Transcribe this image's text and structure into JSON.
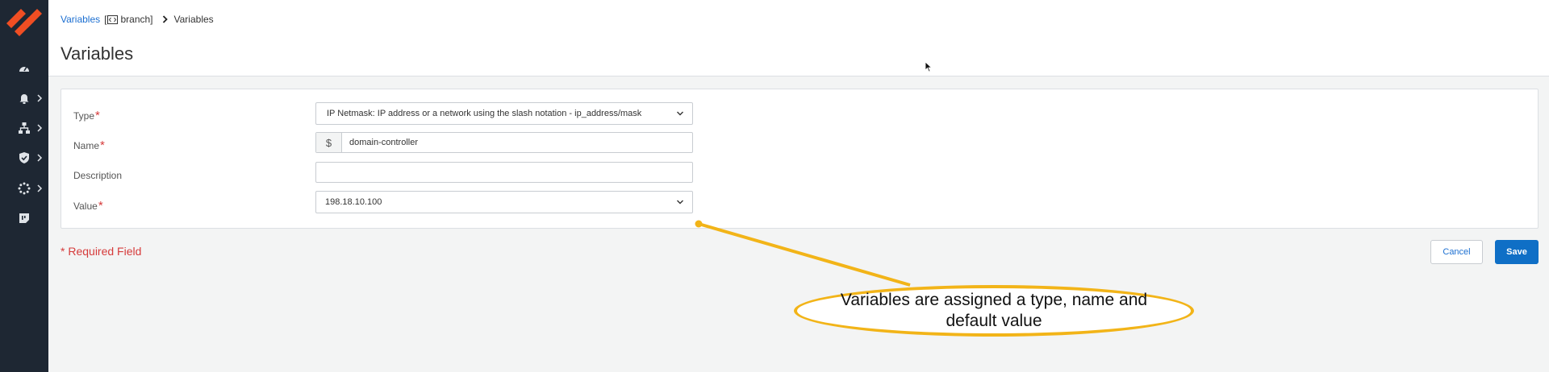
{
  "breadcrumb": {
    "link": "Variables",
    "bracket_open": "[",
    "branch": "branch]",
    "current": "Variables"
  },
  "page_title": "Variables",
  "form": {
    "type": {
      "label": "Type",
      "value": "IP Netmask: IP address or a network using the slash notation - ip_address/mask"
    },
    "name": {
      "label": "Name",
      "prefix": "$",
      "value": "domain-controller"
    },
    "description": {
      "label": "Description",
      "value": ""
    },
    "value": {
      "label": "Value",
      "value": "198.18.10.100"
    },
    "required_marker": "*"
  },
  "required_note": "Required Field",
  "buttons": {
    "cancel": "Cancel",
    "save": "Save"
  },
  "callout": {
    "text": "Variables are assigned a type, name and default value"
  },
  "colors": {
    "sidebar": "#1e2733",
    "brand_orange": "#f04e23",
    "link_blue": "#1c6fd1",
    "save_blue": "#0f6fc6",
    "required_red": "#d63b3b",
    "callout_yellow": "#f2b418"
  },
  "icons": {
    "sidebar": [
      "dashboard-icon",
      "alarm-icon",
      "network-icon",
      "shield-icon",
      "spinner-icon",
      "sticky-note-icon"
    ]
  }
}
